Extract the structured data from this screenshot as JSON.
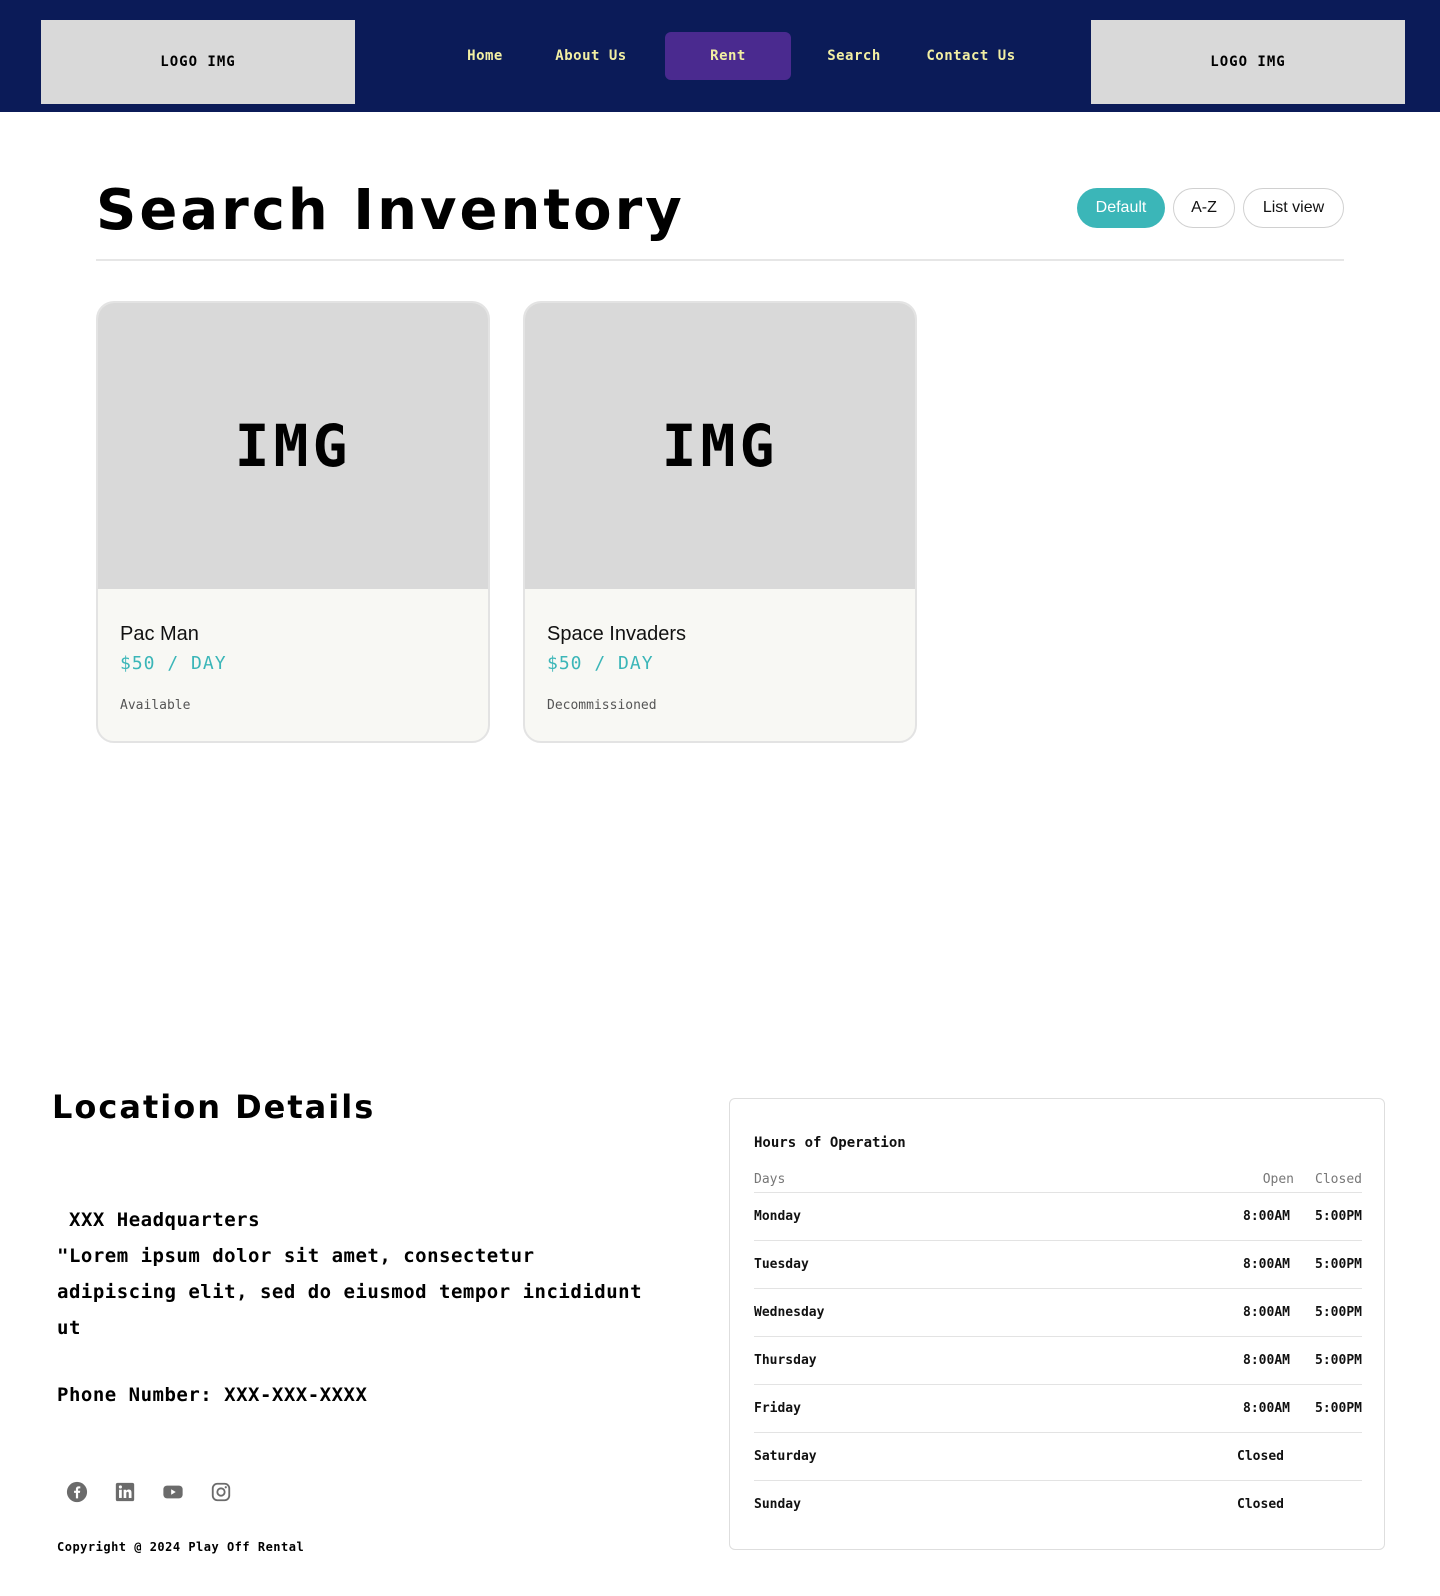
{
  "header": {
    "logo_left": "LOGO IMG",
    "logo_right": "LOGO IMG",
    "nav": {
      "home": "Home",
      "about": "About Us",
      "rent": "Rent",
      "search": "Search",
      "contact": "Contact Us"
    },
    "active_nav": "Rent",
    "background_color": "#0b1b58",
    "nav_text_color": "#f2efa3",
    "active_nav_color": "#4a2a8f"
  },
  "main": {
    "title": "Search Inventory",
    "view_buttons": {
      "default": "Default",
      "az": "A-Z",
      "list": "List view"
    },
    "active_view": "Default",
    "accent_color": "#3bb6b8",
    "cards": [
      {
        "image_label": "IMG",
        "name": "Pac Man",
        "price": "$50 / DAY",
        "status": "Available"
      },
      {
        "image_label": "IMG",
        "name": "Space Invaders",
        "price": "$50 / DAY",
        "status": "Decommissioned"
      }
    ]
  },
  "location": {
    "title": "Location Details",
    "hq": "XXX Headquarters",
    "description": "\"Lorem ipsum dolor sit amet, consectetur adipiscing elit, sed do eiusmod tempor incididunt ut",
    "phone": "Phone Number: XXX-XXX-XXXX",
    "social": [
      "facebook-icon",
      "linkedin-icon",
      "youtube-icon",
      "instagram-icon"
    ],
    "copyright": "Copyright @ 2024 Play Off Rental"
  },
  "hours": {
    "title": "Hours of Operation",
    "headers": {
      "days": "Days",
      "open": "Open",
      "closed": "Closed"
    },
    "rows": [
      {
        "day": "Monday",
        "open": "8:00AM",
        "close": "5:00PM"
      },
      {
        "day": "Tuesday",
        "open": "8:00AM",
        "close": "5:00PM"
      },
      {
        "day": "Wednesday",
        "open": "8:00AM",
        "close": "5:00PM"
      },
      {
        "day": "Thursday",
        "open": "8:00AM",
        "close": "5:00PM"
      },
      {
        "day": "Friday",
        "open": "8:00AM",
        "close": "5:00PM"
      },
      {
        "day": "Saturday",
        "status": "Closed"
      },
      {
        "day": "Sunday",
        "status": "Closed"
      }
    ]
  }
}
